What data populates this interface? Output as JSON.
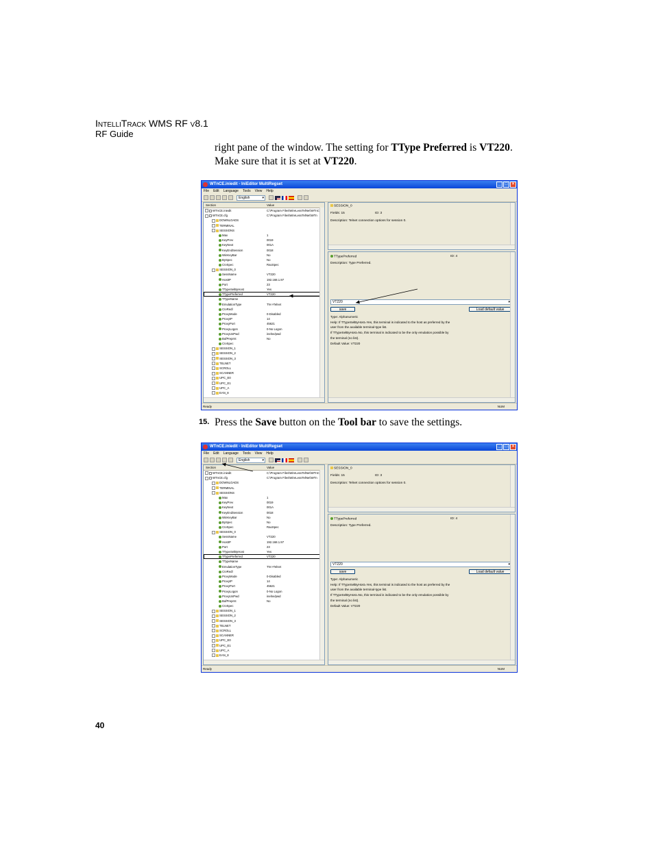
{
  "header": {
    "brand": "IntelliTrack WMS RF v8.1",
    "guide": "RF Guide"
  },
  "intro": {
    "p1a": "right pane of the window. The setting for ",
    "p1b": "TType Preferred",
    "p1c": " is ",
    "p1d": "VT220",
    "p1e": ".",
    "p2a": "Make sure that it is set at ",
    "p2b": "VT220",
    "p2c": "."
  },
  "step15": {
    "number": "15.",
    "a": " Press the ",
    "b": "Save",
    "c": " button on the ",
    "d": "Tool bar",
    "e": " to save the settings."
  },
  "page_number": "40",
  "app": {
    "title": "WTnCE.iniedit - IniEditor MultiRegset",
    "menu": [
      "File",
      "Edit",
      "Language",
      "Tools",
      "View",
      "Help"
    ],
    "language": "English",
    "col_section": "Section",
    "col_value": "Value",
    "status_left": "Ready",
    "status_right": "NUM",
    "tree": [
      {
        "name": "WTnCE.iniedit",
        "value": "C:\\Program Files\\WireLessTelNet\\WTnCE",
        "indent": 0,
        "icon": "doc"
      },
      {
        "name": "WTnCE.cfg",
        "value": "C:\\Program Files\\WireLessTelNet\\WTn",
        "indent": 0,
        "icon": "doc"
      },
      {
        "name": "DOWNLOADS",
        "value": "",
        "indent": 1,
        "icon": "fld"
      },
      {
        "name": "TERMINAL",
        "value": "",
        "indent": 1,
        "icon": "fld"
      },
      {
        "name": "SESSIONS",
        "value": "",
        "indent": 1,
        "icon": "fld"
      },
      {
        "name": "Max",
        "value": "1",
        "indent": 2,
        "icon": "key"
      },
      {
        "name": "KeyPrev",
        "value": "0019",
        "indent": 2,
        "icon": "key"
      },
      {
        "name": "KeyNext",
        "value": "001A",
        "indent": 2,
        "icon": "key"
      },
      {
        "name": "KeyEndSession",
        "value": "0018",
        "indent": 2,
        "icon": "key"
      },
      {
        "name": "WinKeyBar",
        "value": "No",
        "indent": 2,
        "icon": "key"
      },
      {
        "name": "BySpec",
        "value": "No",
        "indent": 2,
        "icon": "key"
      },
      {
        "name": "CrvSpec",
        "value": "RaoSpec",
        "indent": 2,
        "icon": "key"
      },
      {
        "name": "SESSION_0",
        "value": "",
        "indent": 1,
        "icon": "fld"
      },
      {
        "name": "SessName",
        "value": "VT220",
        "indent": 2,
        "icon": "key"
      },
      {
        "name": "HostIP",
        "value": "192.168.1.97",
        "indent": 2,
        "icon": "key"
      },
      {
        "name": "Port",
        "value": "23",
        "indent": 2,
        "icon": "key"
      },
      {
        "name": "TTypeSelByHost",
        "value": "Yes",
        "indent": 2,
        "icon": "key"
      },
      {
        "name": "TTypePreferred",
        "value": "VT220",
        "indent": 2,
        "icon": "key",
        "selected": true
      },
      {
        "name": "TTypeName",
        "value": "",
        "indent": 2,
        "icon": "key"
      },
      {
        "name": "EmulationType",
        "value": "TN->Telnet",
        "indent": 2,
        "icon": "key"
      },
      {
        "name": "CrvRedl",
        "value": "",
        "indent": 2,
        "icon": "key"
      },
      {
        "name": "ProxyMode",
        "value": "0-Disabled",
        "indent": 2,
        "icon": "key"
      },
      {
        "name": "ProxyIP",
        "value": "14",
        "indent": 2,
        "icon": "key"
      },
      {
        "name": "ProxyPort",
        "value": "45621",
        "indent": 2,
        "icon": "key"
      },
      {
        "name": "ProxyLogon",
        "value": "0-No Logon",
        "indent": 2,
        "icon": "key"
      },
      {
        "name": "ProxyUsPwd",
        "value": "inelne/pwd",
        "indent": 2,
        "icon": "key"
      },
      {
        "name": "BufPreprnt",
        "value": "No",
        "indent": 2,
        "icon": "key"
      },
      {
        "name": "CrvSpec",
        "value": "",
        "indent": 2,
        "icon": "key"
      },
      {
        "name": "SESSION_1",
        "value": "",
        "indent": 1,
        "icon": "fld"
      },
      {
        "name": "SESSION_2",
        "value": "",
        "indent": 1,
        "icon": "fld"
      },
      {
        "name": "SESSION_3",
        "value": "",
        "indent": 1,
        "icon": "fld"
      },
      {
        "name": "TELNET",
        "value": "",
        "indent": 1,
        "icon": "fld"
      },
      {
        "name": "SCROLL",
        "value": "",
        "indent": 1,
        "icon": "fld"
      },
      {
        "name": "SCANNER",
        "value": "",
        "indent": 1,
        "icon": "fld"
      },
      {
        "name": "UPC_E0",
        "value": "",
        "indent": 1,
        "icon": "fld"
      },
      {
        "name": "UPC_E1",
        "value": "",
        "indent": 1,
        "icon": "fld"
      },
      {
        "name": "UPC_A",
        "value": "",
        "indent": 1,
        "icon": "fld"
      },
      {
        "name": "EAN_8",
        "value": "",
        "indent": 1,
        "icon": "fld"
      }
    ],
    "top_pane": {
      "section": "SESSION_0",
      "fields": "Fields: 15",
      "id": "ID: 3",
      "description": "Description: Telnet connection options for session 0."
    },
    "bottom_pane": {
      "key": "TTypePreferred",
      "id": "ID: 4",
      "description": "Description: Type Preferred.",
      "value": "VT220",
      "save": "save",
      "load_default": "Load default value",
      "help": [
        "Type: Alphanumeric",
        "Help: If TTypeSelByHost=Yes, this terminal is indicated to the host as preferred by the",
        "user from the available terminal-type list.",
        "If TTypeSelByHost=No, this terminal is indicated to be the only emulation possible by",
        "the terminal (no list).",
        "Default Value: VT220"
      ]
    }
  }
}
